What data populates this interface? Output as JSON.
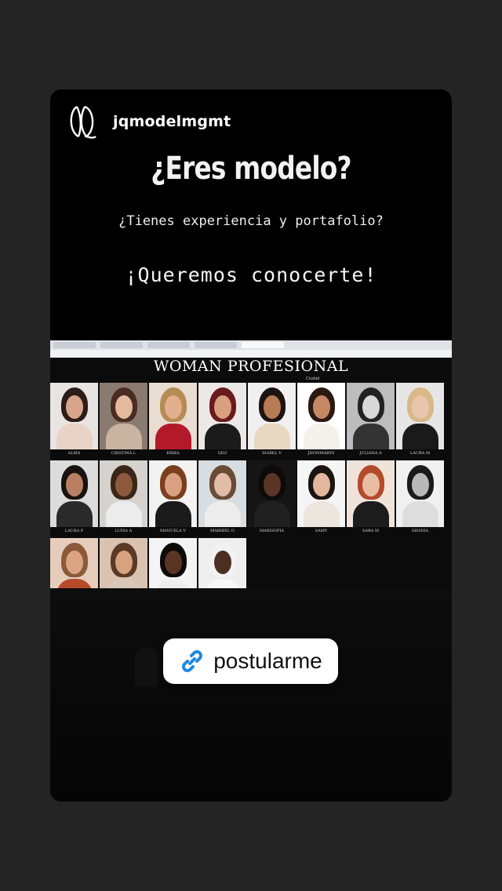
{
  "account": {
    "username": "jqmodelmgmt"
  },
  "story": {
    "headline": "¿Eres modelo?",
    "subline": "¿Tienes experiencia y portafolio?",
    "callout": "¡Queremos conocerte!"
  },
  "website": {
    "title": "WOMAN PROFESIONAL",
    "filter_label": "Ciudad",
    "models": [
      {
        "name": "ALMA",
        "skin": "#d9a58a",
        "hair": "#2b1d17",
        "top": "#e9d3c7",
        "bg": "#e8e4e2"
      },
      {
        "name": "CRISTINA L",
        "skin": "#e3b9a0",
        "hair": "#4a2d22",
        "top": "#c9b3a1",
        "bg": "#8a7a70"
      },
      {
        "name": "ERIKA",
        "skin": "#e2b08f",
        "hair": "#b88a55",
        "top": "#b4192a",
        "bg": "#e9dcd1"
      },
      {
        "name": "GEO",
        "skin": "#d9a07f",
        "hair": "#6b1a1c",
        "top": "#1b1b1b",
        "bg": "#ece8e6"
      },
      {
        "name": "ISABEL V",
        "skin": "#b77b55",
        "hair": "#1d1410",
        "top": "#e8d8c2",
        "bg": "#f0f0f0"
      },
      {
        "name": "JHONMARYS",
        "skin": "#c58862",
        "hair": "#2a1a12",
        "top": "#f4f1ea",
        "bg": "#ffffff"
      },
      {
        "name": "JULIANA A",
        "skin": "#d8d8d8",
        "hair": "#222222",
        "top": "#333333",
        "bg": "#bdbdbd"
      },
      {
        "name": "LAURA M",
        "skin": "#e8c6ae",
        "hair": "#d8b887",
        "top": "#1a1a1a",
        "bg": "#e6e6e6"
      },
      {
        "name": "LAURA P",
        "skin": "#b98064",
        "hair": "#1a120e",
        "top": "#2a2a2a",
        "bg": "#dcdcdc"
      },
      {
        "name": "LUISA A",
        "skin": "#8d5a3e",
        "hair": "#3a2618",
        "top": "#ececec",
        "bg": "#d6d2cd"
      },
      {
        "name": "MANUELA V",
        "skin": "#d9a182",
        "hair": "#7b3f1f",
        "top": "#1a1a1a",
        "bg": "#f2f2f2"
      },
      {
        "name": "MARIBEL O",
        "skin": "#e1bda7",
        "hair": "#6b4b36",
        "top": "#ededed",
        "bg": "#d7dde0"
      },
      {
        "name": "MARISOFIA",
        "skin": "#5a3526",
        "hair": "#0f0a08",
        "top": "#202020",
        "bg": "#151515"
      },
      {
        "name": "SAMY",
        "skin": "#e3b79d",
        "hair": "#1b1411",
        "top": "#ece6df",
        "bg": "#f5f5f5"
      },
      {
        "name": "SARA M",
        "skin": "#e7bda3",
        "hair": "#b34a2c",
        "top": "#1c1c1c",
        "bg": "#efe3da"
      },
      {
        "name": "SHADIA",
        "skin": "#b9b9b9",
        "hair": "#1a1a1a",
        "top": "#dddddd",
        "bg": "#f0f0f0"
      },
      {
        "name": "",
        "skin": "#dba384",
        "hair": "#8a5a3a",
        "top": "#b84a2a",
        "bg": "#e6cdbb"
      },
      {
        "name": "",
        "skin": "#d7a27f",
        "hair": "#5a3a26",
        "top": "#d7c8b9",
        "bg": "#d9c2b0"
      },
      {
        "name": "",
        "skin": "#5b3423",
        "hair": "#0e0a08",
        "top": "#eeeeee",
        "bg": "#f4f4f4"
      },
      {
        "name": "",
        "skin": "#4d2f22",
        "hair": "#f2f2f2",
        "top": "#f7f7f7",
        "bg": "#eeeeee"
      }
    ]
  },
  "link_sticker": {
    "label": "postularme"
  },
  "colors": {
    "story_bg": "#000000",
    "page_bg": "#242424",
    "sticker_bg": "#ffffff",
    "link_accent": "#1e88e5"
  }
}
